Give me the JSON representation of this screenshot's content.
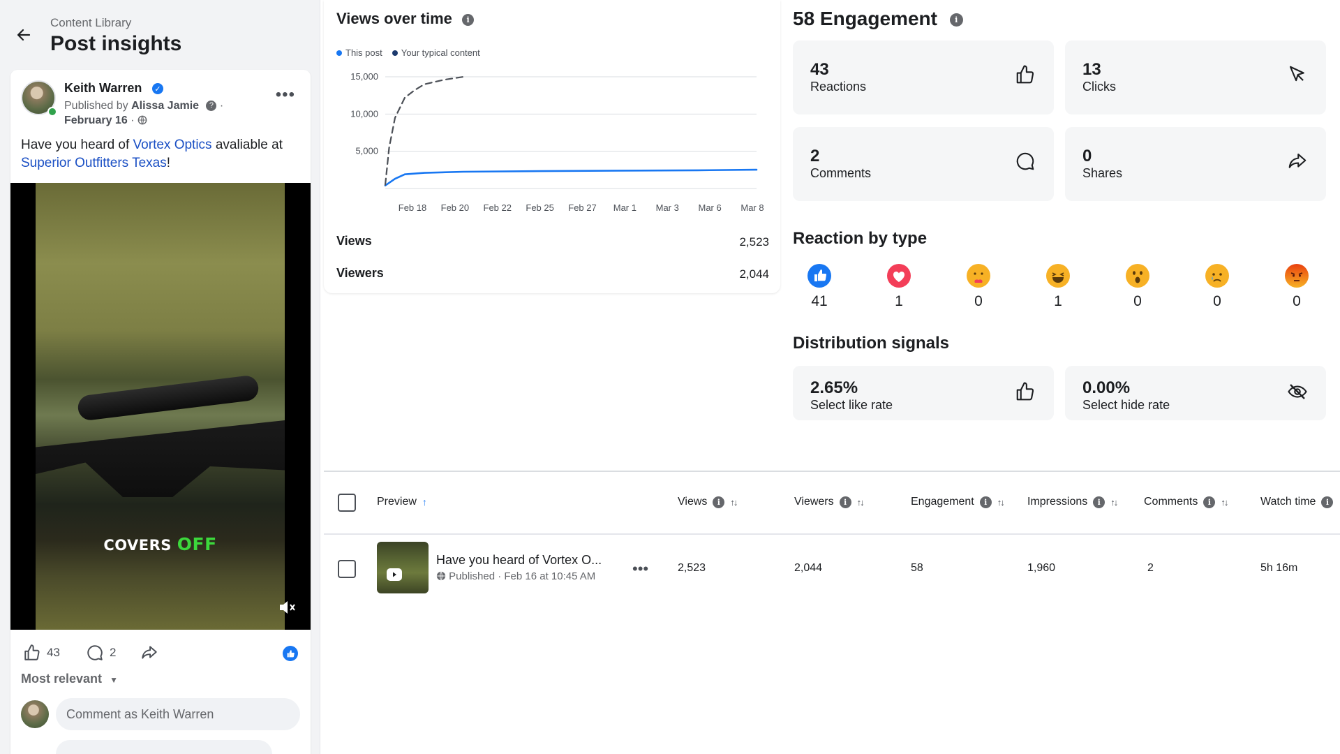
{
  "header": {
    "breadcrumb": "Content Library",
    "title": "Post insights"
  },
  "post": {
    "author": "Keith Warren",
    "published_by_prefix": "Published by",
    "publisher": "Alissa Jamie",
    "date": "February 16",
    "text_prefix": "Have you heard of ",
    "link1": "Vortex Optics",
    "text_mid": " avaliable at",
    "link2": "Superior Outfitters Texas",
    "text_suffix": "!",
    "video_caption_1": "COVERS",
    "video_caption_2": "OFF",
    "likes": "43",
    "comments": "2",
    "sort_label": "Most relevant",
    "comment_placeholder": "Comment as Keith Warren"
  },
  "views_over_time": {
    "title": "Views over time",
    "legend": [
      "This post",
      "Your typical content"
    ],
    "views_label": "Views",
    "views_value": "2,523",
    "viewers_label": "Viewers",
    "viewers_value": "2,044"
  },
  "chart_data": {
    "type": "line",
    "title": "Views over time",
    "x_ticks": [
      "Feb 18",
      "Feb 20",
      "Feb 22",
      "Feb 25",
      "Feb 27",
      "Mar 1",
      "Mar 3",
      "Mar 6",
      "Mar 8"
    ],
    "y_ticks": [
      "15,000",
      "10,000",
      "5,000"
    ],
    "ylim": [
      0,
      15000
    ],
    "grid": true,
    "legend_position": "top-left",
    "series": [
      {
        "name": "This post",
        "color": "#1877f2",
        "style": "solid",
        "x": [
          0,
          0.5,
          1,
          2,
          4,
          8,
          12,
          16,
          19
        ],
        "y": [
          400,
          1300,
          1900,
          2100,
          2250,
          2330,
          2400,
          2450,
          2523
        ]
      },
      {
        "name": "Your typical content",
        "color": "#4b4f56",
        "style": "dashed",
        "x": [
          0,
          0.2,
          0.5,
          1,
          1.5,
          2,
          3,
          4
        ],
        "y": [
          500,
          5500,
          9500,
          12200,
          13200,
          14000,
          14600,
          15000
        ]
      }
    ],
    "x_domain": [
      0,
      19
    ]
  },
  "engagement": {
    "title": "58 Engagement",
    "cards": [
      {
        "value": "43",
        "label": "Reactions",
        "icon": "thumbs-up-icon"
      },
      {
        "value": "13",
        "label": "Clicks",
        "icon": "cursor-icon"
      },
      {
        "value": "2",
        "label": "Comments",
        "icon": "comment-icon"
      },
      {
        "value": "0",
        "label": "Shares",
        "icon": "share-icon"
      }
    ]
  },
  "reactions": {
    "title": "Reaction by type",
    "items": [
      {
        "type": "like",
        "count": "41",
        "color": "#1877f2"
      },
      {
        "type": "love",
        "count": "1",
        "color": "#f33e58"
      },
      {
        "type": "care",
        "count": "0",
        "color": "#f7b125"
      },
      {
        "type": "haha",
        "count": "1",
        "color": "#f7b125"
      },
      {
        "type": "wow",
        "count": "0",
        "color": "#f7b125"
      },
      {
        "type": "sad",
        "count": "0",
        "color": "#f7b125"
      },
      {
        "type": "angry",
        "count": "0",
        "color": "#e9710f"
      }
    ]
  },
  "distribution": {
    "title": "Distribution signals",
    "cards": [
      {
        "value": "2.65%",
        "label": "Select like rate",
        "icon": "thumbs-up-icon"
      },
      {
        "value": "0.00%",
        "label": "Select hide rate",
        "icon": "eye-off-icon"
      }
    ]
  },
  "table": {
    "columns": [
      "Preview",
      "Views",
      "Viewers",
      "Engagement",
      "Impressions",
      "Comments",
      "Watch time"
    ],
    "row": {
      "title": "Have you heard of Vortex O...",
      "subtitle": "Published · Feb 16 at 10:45 AM",
      "views": "2,523",
      "viewers": "2,044",
      "engagement": "58",
      "impressions": "1,960",
      "comments": "2",
      "watch_time": "5h 16m"
    }
  },
  "colors": {
    "accent": "#1877f2",
    "link": "#1a4fc4",
    "card_bg": "#f5f6f7"
  }
}
